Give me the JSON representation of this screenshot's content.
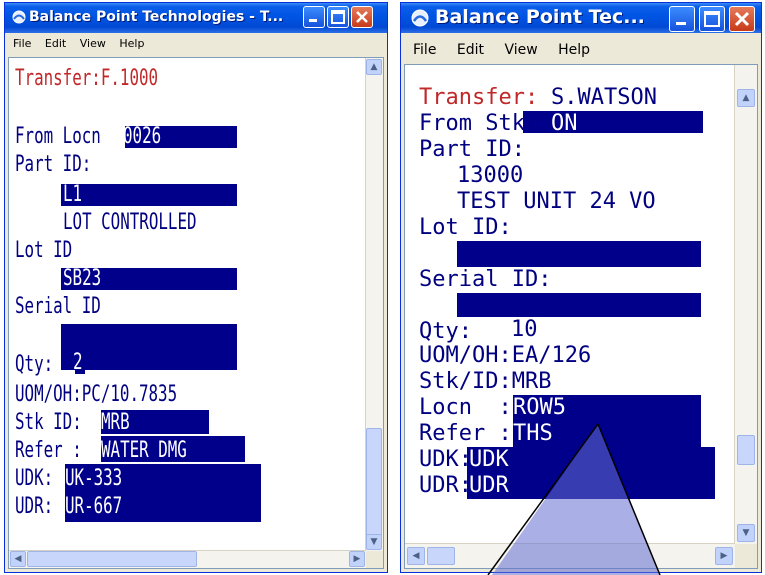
{
  "window_left": {
    "title": "Balance Point Technologies - T...",
    "menu": [
      "File",
      "Edit",
      "View",
      "Help"
    ],
    "lines": {
      "transfer": "Transfer:F.1000",
      "from_locn_label": "From Locn ",
      "from_locn_value": "0026",
      "part_id_label": "Part ID:",
      "part_id_value": "L1",
      "part_desc": "LOT CONTROLLED",
      "lot_id_label": "Lot ID",
      "lot_id_value": "SB23",
      "serial_id_label": "Serial ID",
      "serial_id_value": "",
      "qty_label": "Qty:",
      "qty_value": "2",
      "uom": "UOM/OH:PC/10.7835",
      "stk_id_label": "Stk ID:",
      "stk_id_value": "MRB",
      "refer_label": "Refer :",
      "refer_value": "WATER DMG",
      "udk_label": "UDK:",
      "udk_value": "UK-333",
      "udr_label": "UDR:",
      "udr_value": "UR-667"
    }
  },
  "window_right": {
    "title": "Balance Point Tec...",
    "menu": [
      "File",
      "Edit",
      "View",
      "Help"
    ],
    "lines": {
      "transfer_label": "Transfer:",
      "transfer_value": "S.WATSON",
      "from_stk_label": "From Stk: C",
      "from_stk_value": "ON",
      "part_id_label": "Part ID:",
      "part_number": "13000",
      "part_desc": "TEST UNIT 24 VO",
      "lot_id_label": "Lot ID:",
      "serial_id_label": "Serial ID:",
      "qty_label": "Qty:",
      "qty_value": "10",
      "uom": "UOM/OH:EA/126",
      "stk_id": "Stk/ID:MRB",
      "locn_label": "Locn  :",
      "locn_value": "ROW5",
      "refer_label": "Refer :",
      "refer_value": "THS",
      "udk_label": "UDK:",
      "udk_value": "UDK",
      "udr_label": "UDR:",
      "udr_value": "UDR"
    }
  },
  "colors": {
    "title_blue": "#0054e3",
    "field_highlight": "#00008b",
    "text_navy": "#000080",
    "text_red": "#c0282a"
  }
}
